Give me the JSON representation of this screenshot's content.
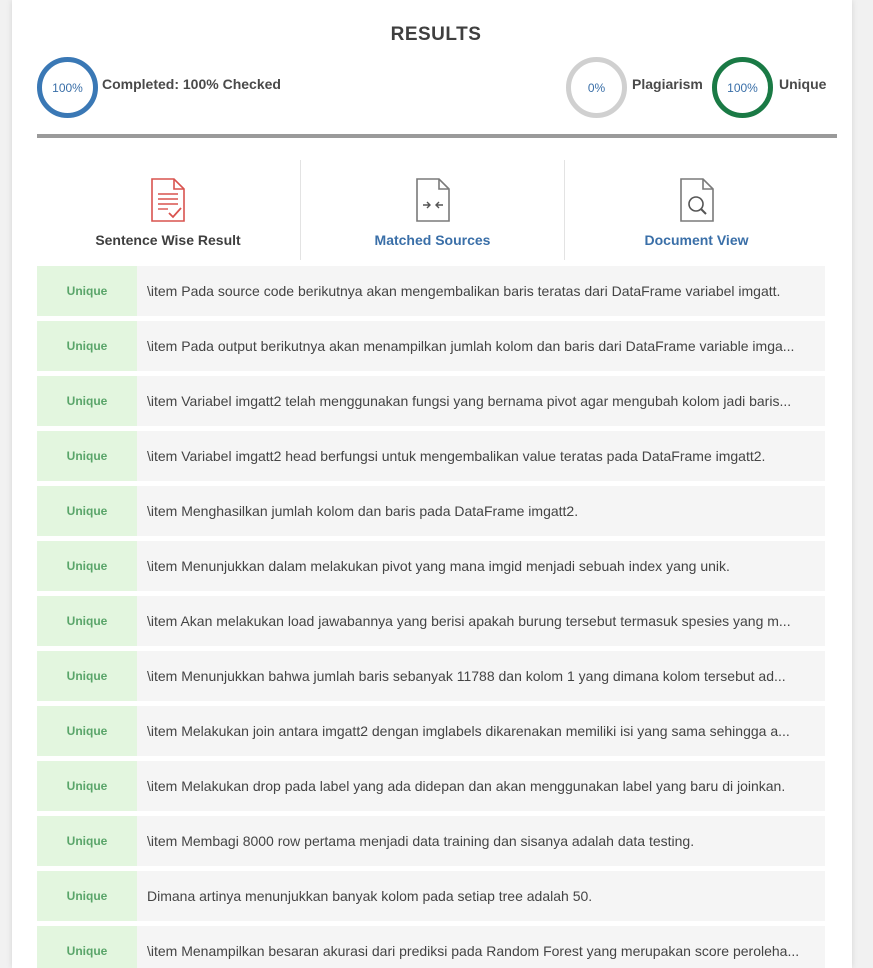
{
  "header": {
    "title": "RESULTS"
  },
  "stats": {
    "completed": {
      "percent": "100%",
      "label": "Completed: 100% Checked"
    },
    "plagiarism": {
      "percent": "0%",
      "label": "Plagiarism"
    },
    "unique": {
      "percent": "100%",
      "label": "Unique"
    }
  },
  "colors": {
    "completed_ring": "#3a78b5",
    "plagiarism_ring": "#d0d0d0",
    "unique_ring": "#1a7a45",
    "badge_bg": "#e3f6df",
    "badge_text": "#5aa56a",
    "link": "#3a6fa8"
  },
  "tabs": [
    {
      "label": "Sentence Wise Result",
      "icon": "document-check-icon"
    },
    {
      "label": "Matched Sources",
      "icon": "document-compare-icon"
    },
    {
      "label": "Document View",
      "icon": "document-search-icon"
    }
  ],
  "results": [
    {
      "status": "Unique",
      "text": "\\item Pada source code berikutnya akan mengembalikan baris teratas dari DataFrame variabel imgatt."
    },
    {
      "status": "Unique",
      "text": "\\item Pada output berikutnya akan menampilkan jumlah kolom dan baris dari DataFrame variable imga..."
    },
    {
      "status": "Unique",
      "text": "\\item Variabel imgatt2 telah menggunakan fungsi yang bernama pivot agar mengubah kolom jadi baris..."
    },
    {
      "status": "Unique",
      "text": "\\item Variabel imgatt2 head berfungsi untuk mengembalikan value teratas pada DataFrame imgatt2."
    },
    {
      "status": "Unique",
      "text": "\\item Menghasilkan jumlah kolom dan baris pada DataFrame imgatt2."
    },
    {
      "status": "Unique",
      "text": "\\item Menunjukkan dalam melakukan pivot yang mana imgid menjadi sebuah index yang unik."
    },
    {
      "status": "Unique",
      "text": "\\item Akan melakukan load jawabannya yang berisi apakah burung tersebut termasuk spesies yang m..."
    },
    {
      "status": "Unique",
      "text": "\\item Menunjukkan bahwa jumlah baris sebanyak 11788 dan kolom 1 yang dimana kolom tersebut ad..."
    },
    {
      "status": "Unique",
      "text": "\\item Melakukan join antara imgatt2 dengan imglabels dikarenakan memiliki isi yang sama sehingga a..."
    },
    {
      "status": "Unique",
      "text": "\\item Melakukan drop pada label yang ada didepan dan akan menggunakan label yang baru di joinkan."
    },
    {
      "status": "Unique",
      "text": "\\item Membagi 8000 row pertama menjadi data training dan sisanya adalah data testing."
    },
    {
      "status": "Unique",
      "text": "Dimana artinya menunjukkan banyak kolom pada setiap tree adalah 50."
    },
    {
      "status": "Unique",
      "text": "\\item Menampilkan besaran akurasi dari prediksi pada Random Forest yang merupakan score peroleha..."
    }
  ]
}
